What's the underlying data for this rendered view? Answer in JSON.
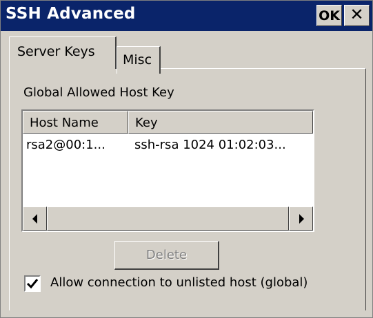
{
  "window": {
    "title": "SSH Advanced",
    "ok_label": "OK",
    "close_glyph": "✕"
  },
  "tabs": [
    {
      "label": "Server Keys",
      "active": true
    },
    {
      "label": "Misc",
      "active": false
    }
  ],
  "server_keys": {
    "section_label": "Global Allowed Host Key",
    "columns": [
      "Host Name",
      "Key"
    ],
    "rows": [
      {
        "host": "rsa2@00:1...",
        "key": "ssh-rsa 1024 01:02:03..."
      }
    ],
    "delete_label": "Delete",
    "delete_enabled": false,
    "allow_unlisted": {
      "label": "Allow connection to unlisted host (global)",
      "checked": true
    }
  },
  "icons": {
    "scroll_left": "scroll-left-icon",
    "scroll_right": "scroll-right-icon",
    "checkmark": "checkmark-icon"
  },
  "colors": {
    "titlebar": "#0a246a",
    "face": "#d4d0c8"
  }
}
